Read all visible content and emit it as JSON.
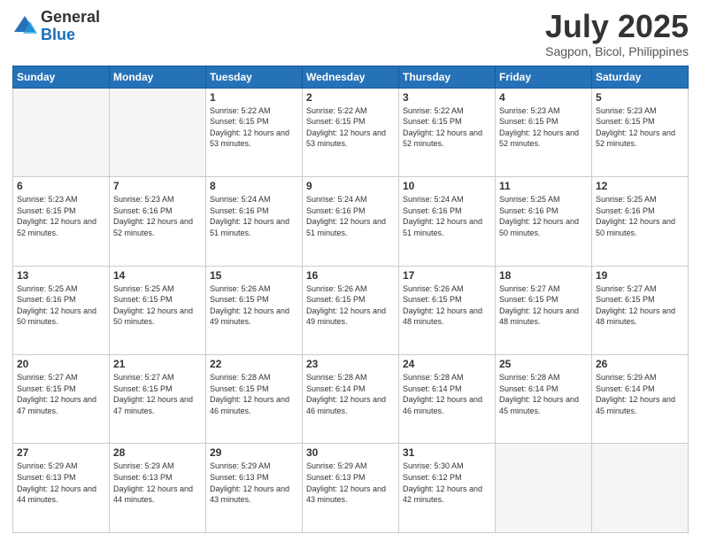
{
  "logo": {
    "general": "General",
    "blue": "Blue"
  },
  "header": {
    "month": "July 2025",
    "location": "Sagpon, Bicol, Philippines"
  },
  "days_of_week": [
    "Sunday",
    "Monday",
    "Tuesday",
    "Wednesday",
    "Thursday",
    "Friday",
    "Saturday"
  ],
  "weeks": [
    [
      {
        "day": "",
        "empty": true
      },
      {
        "day": "",
        "empty": true
      },
      {
        "day": "1",
        "sunrise": "Sunrise: 5:22 AM",
        "sunset": "Sunset: 6:15 PM",
        "daylight": "Daylight: 12 hours and 53 minutes."
      },
      {
        "day": "2",
        "sunrise": "Sunrise: 5:22 AM",
        "sunset": "Sunset: 6:15 PM",
        "daylight": "Daylight: 12 hours and 53 minutes."
      },
      {
        "day": "3",
        "sunrise": "Sunrise: 5:22 AM",
        "sunset": "Sunset: 6:15 PM",
        "daylight": "Daylight: 12 hours and 52 minutes."
      },
      {
        "day": "4",
        "sunrise": "Sunrise: 5:23 AM",
        "sunset": "Sunset: 6:15 PM",
        "daylight": "Daylight: 12 hours and 52 minutes."
      },
      {
        "day": "5",
        "sunrise": "Sunrise: 5:23 AM",
        "sunset": "Sunset: 6:15 PM",
        "daylight": "Daylight: 12 hours and 52 minutes."
      }
    ],
    [
      {
        "day": "6",
        "sunrise": "Sunrise: 5:23 AM",
        "sunset": "Sunset: 6:15 PM",
        "daylight": "Daylight: 12 hours and 52 minutes."
      },
      {
        "day": "7",
        "sunrise": "Sunrise: 5:23 AM",
        "sunset": "Sunset: 6:16 PM",
        "daylight": "Daylight: 12 hours and 52 minutes."
      },
      {
        "day": "8",
        "sunrise": "Sunrise: 5:24 AM",
        "sunset": "Sunset: 6:16 PM",
        "daylight": "Daylight: 12 hours and 51 minutes."
      },
      {
        "day": "9",
        "sunrise": "Sunrise: 5:24 AM",
        "sunset": "Sunset: 6:16 PM",
        "daylight": "Daylight: 12 hours and 51 minutes."
      },
      {
        "day": "10",
        "sunrise": "Sunrise: 5:24 AM",
        "sunset": "Sunset: 6:16 PM",
        "daylight": "Daylight: 12 hours and 51 minutes."
      },
      {
        "day": "11",
        "sunrise": "Sunrise: 5:25 AM",
        "sunset": "Sunset: 6:16 PM",
        "daylight": "Daylight: 12 hours and 50 minutes."
      },
      {
        "day": "12",
        "sunrise": "Sunrise: 5:25 AM",
        "sunset": "Sunset: 6:16 PM",
        "daylight": "Daylight: 12 hours and 50 minutes."
      }
    ],
    [
      {
        "day": "13",
        "sunrise": "Sunrise: 5:25 AM",
        "sunset": "Sunset: 6:16 PM",
        "daylight": "Daylight: 12 hours and 50 minutes."
      },
      {
        "day": "14",
        "sunrise": "Sunrise: 5:25 AM",
        "sunset": "Sunset: 6:15 PM",
        "daylight": "Daylight: 12 hours and 50 minutes."
      },
      {
        "day": "15",
        "sunrise": "Sunrise: 5:26 AM",
        "sunset": "Sunset: 6:15 PM",
        "daylight": "Daylight: 12 hours and 49 minutes."
      },
      {
        "day": "16",
        "sunrise": "Sunrise: 5:26 AM",
        "sunset": "Sunset: 6:15 PM",
        "daylight": "Daylight: 12 hours and 49 minutes."
      },
      {
        "day": "17",
        "sunrise": "Sunrise: 5:26 AM",
        "sunset": "Sunset: 6:15 PM",
        "daylight": "Daylight: 12 hours and 48 minutes."
      },
      {
        "day": "18",
        "sunrise": "Sunrise: 5:27 AM",
        "sunset": "Sunset: 6:15 PM",
        "daylight": "Daylight: 12 hours and 48 minutes."
      },
      {
        "day": "19",
        "sunrise": "Sunrise: 5:27 AM",
        "sunset": "Sunset: 6:15 PM",
        "daylight": "Daylight: 12 hours and 48 minutes."
      }
    ],
    [
      {
        "day": "20",
        "sunrise": "Sunrise: 5:27 AM",
        "sunset": "Sunset: 6:15 PM",
        "daylight": "Daylight: 12 hours and 47 minutes."
      },
      {
        "day": "21",
        "sunrise": "Sunrise: 5:27 AM",
        "sunset": "Sunset: 6:15 PM",
        "daylight": "Daylight: 12 hours and 47 minutes."
      },
      {
        "day": "22",
        "sunrise": "Sunrise: 5:28 AM",
        "sunset": "Sunset: 6:15 PM",
        "daylight": "Daylight: 12 hours and 46 minutes."
      },
      {
        "day": "23",
        "sunrise": "Sunrise: 5:28 AM",
        "sunset": "Sunset: 6:14 PM",
        "daylight": "Daylight: 12 hours and 46 minutes."
      },
      {
        "day": "24",
        "sunrise": "Sunrise: 5:28 AM",
        "sunset": "Sunset: 6:14 PM",
        "daylight": "Daylight: 12 hours and 46 minutes."
      },
      {
        "day": "25",
        "sunrise": "Sunrise: 5:28 AM",
        "sunset": "Sunset: 6:14 PM",
        "daylight": "Daylight: 12 hours and 45 minutes."
      },
      {
        "day": "26",
        "sunrise": "Sunrise: 5:29 AM",
        "sunset": "Sunset: 6:14 PM",
        "daylight": "Daylight: 12 hours and 45 minutes."
      }
    ],
    [
      {
        "day": "27",
        "sunrise": "Sunrise: 5:29 AM",
        "sunset": "Sunset: 6:13 PM",
        "daylight": "Daylight: 12 hours and 44 minutes."
      },
      {
        "day": "28",
        "sunrise": "Sunrise: 5:29 AM",
        "sunset": "Sunset: 6:13 PM",
        "daylight": "Daylight: 12 hours and 44 minutes."
      },
      {
        "day": "29",
        "sunrise": "Sunrise: 5:29 AM",
        "sunset": "Sunset: 6:13 PM",
        "daylight": "Daylight: 12 hours and 43 minutes."
      },
      {
        "day": "30",
        "sunrise": "Sunrise: 5:29 AM",
        "sunset": "Sunset: 6:13 PM",
        "daylight": "Daylight: 12 hours and 43 minutes."
      },
      {
        "day": "31",
        "sunrise": "Sunrise: 5:30 AM",
        "sunset": "Sunset: 6:12 PM",
        "daylight": "Daylight: 12 hours and 42 minutes."
      },
      {
        "day": "",
        "empty": true
      },
      {
        "day": "",
        "empty": true
      }
    ]
  ]
}
